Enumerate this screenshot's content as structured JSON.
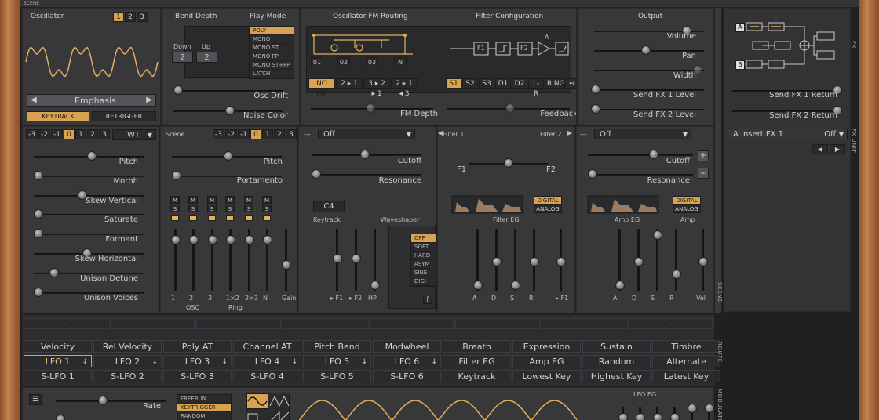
{
  "app": {
    "scene_label": "SCENE"
  },
  "osc": {
    "title": "Oscillator",
    "nums": [
      "1",
      "2",
      "3"
    ],
    "patch": "Emphasis",
    "keytrack": "KEYTRACK",
    "retrigger": "RETRIGGER"
  },
  "bend": {
    "title": "Bend Depth",
    "down_label": "Down",
    "up_label": "Up",
    "down": "2",
    "up": "2"
  },
  "playmode": {
    "title": "Play Mode",
    "options": [
      "POLY",
      "MONO",
      "MONO ST",
      "MONO FP",
      "MONO ST+FP",
      "LATCH"
    ]
  },
  "drift": {
    "osc_drift": "Osc Drift",
    "noise_color": "Noise Color"
  },
  "fm": {
    "title": "Oscillator FM Routing",
    "nodes": [
      "01",
      "02",
      "03",
      "N"
    ],
    "buttons": [
      "NO FM",
      "2 ▸ 1",
      "3 ▸ 2 ▸ 1",
      "2 ▸ 1 ◂ 3"
    ],
    "depth": "FM Depth"
  },
  "filtercfg": {
    "title": "Filter Configuration",
    "buttons": [
      "S1",
      "S2",
      "S3",
      "D1",
      "D2",
      "L-R",
      "RING",
      "↔"
    ],
    "feedback": "Feedback",
    "nodes": [
      "F1",
      "F2",
      "A"
    ]
  },
  "output": {
    "title": "Output",
    "knobs": [
      "Volume",
      "Pan",
      "Width",
      "Send FX 1 Level",
      "Send FX 2 Level"
    ]
  },
  "fxpanel": {
    "returns": [
      "Send FX 1 Return",
      "Send FX 2 Return"
    ],
    "insert": "A Insert FX 1",
    "insert_value": "Off",
    "side_fx": "FX",
    "side_unit": "FX UNIT",
    "abA": "A",
    "abB": "B"
  },
  "oscp": {
    "nums": [
      "-3",
      "-2",
      "-1",
      "0",
      "1",
      "2",
      "3"
    ],
    "type": "WT",
    "knobs": [
      "Pitch",
      "Morph",
      "Skew Vertical",
      "Saturate",
      "Formant",
      "Skew Horizontal",
      "Unison Detune",
      "Unison Voices"
    ]
  },
  "scene": {
    "title": "Scene",
    "nums": [
      "-3",
      "-2",
      "-1",
      "0",
      "1",
      "2",
      "3"
    ],
    "pitch": "Pitch",
    "portamento": "Portamento",
    "mute": "M",
    "solo": "S",
    "mixer": [
      "1",
      "2",
      "3",
      "1×2",
      "2×3",
      "N",
      "Gain"
    ],
    "osc_label": "OSC",
    "ring_label": "Ring"
  },
  "filter1": {
    "dash": "---",
    "type": "Off",
    "cutoff": "Cutoff",
    "resonance": "Resonance",
    "keytrack_note": "C4",
    "keytrack": "Keytrack",
    "waveshaper": "Waveshaper",
    "ws_options": [
      "OFF",
      "SOFT",
      "HARD",
      "ASYM",
      "SINE",
      "DIGI"
    ],
    "faders": [
      "▸ F1",
      "▸ F2",
      "HP"
    ]
  },
  "filtereg": {
    "f1": "Filter 1",
    "f2": "Filter 2",
    "left": "F1",
    "right": "F2",
    "digital": "DIGITAL",
    "analog": "ANALOG",
    "title": "Filter EG",
    "faders": [
      "A",
      "D",
      "S",
      "R",
      "▸ F1",
      "▸ F2"
    ]
  },
  "filter2": {
    "dash": "---",
    "type": "Off",
    "cutoff": "Cutoff",
    "resonance": "Resonance"
  },
  "ampeg": {
    "title": "Amp EG",
    "amp": "Amp",
    "digital": "DIGITAL",
    "analog": "ANALOG",
    "faders": [
      "A",
      "D",
      "S",
      "R",
      "Vel",
      "▸ Gain"
    ]
  },
  "sides": {
    "scene": "SCENE",
    "route": "ROUTE",
    "modulation": "MODULATION"
  },
  "route": {
    "dashes": [
      "-",
      "-",
      "-",
      "-",
      "-",
      "-",
      "-",
      "-"
    ],
    "row1": [
      "Velocity",
      "Rel Velocity",
      "Poly AT",
      "Channel AT",
      "Pitch Bend",
      "Modwheel",
      "Breath",
      "Expression",
      "Sustain",
      "Timbre"
    ],
    "row2": [
      "LFO 1",
      "LFO 2",
      "LFO 3",
      "LFO 4",
      "LFO 5",
      "LFO 6",
      "Filter EG",
      "Amp EG",
      "Random",
      "Alternate"
    ],
    "row3": [
      "S-LFO 1",
      "S-LFO 2",
      "S-LFO 3",
      "S-LFO 4",
      "S-LFO 5",
      "S-LFO 6",
      "Keytrack",
      "Lowest Key",
      "Highest Key",
      "Latest Key"
    ],
    "down": "↓"
  },
  "lfo": {
    "rate": "Rate",
    "modes": [
      "FREERUN",
      "KEYTRIGGER",
      "RANDOM"
    ],
    "eg": "LFO EG"
  },
  "colors": {
    "accent": "#d9a24f",
    "panel": "#38383b",
    "bg": "#202022"
  }
}
